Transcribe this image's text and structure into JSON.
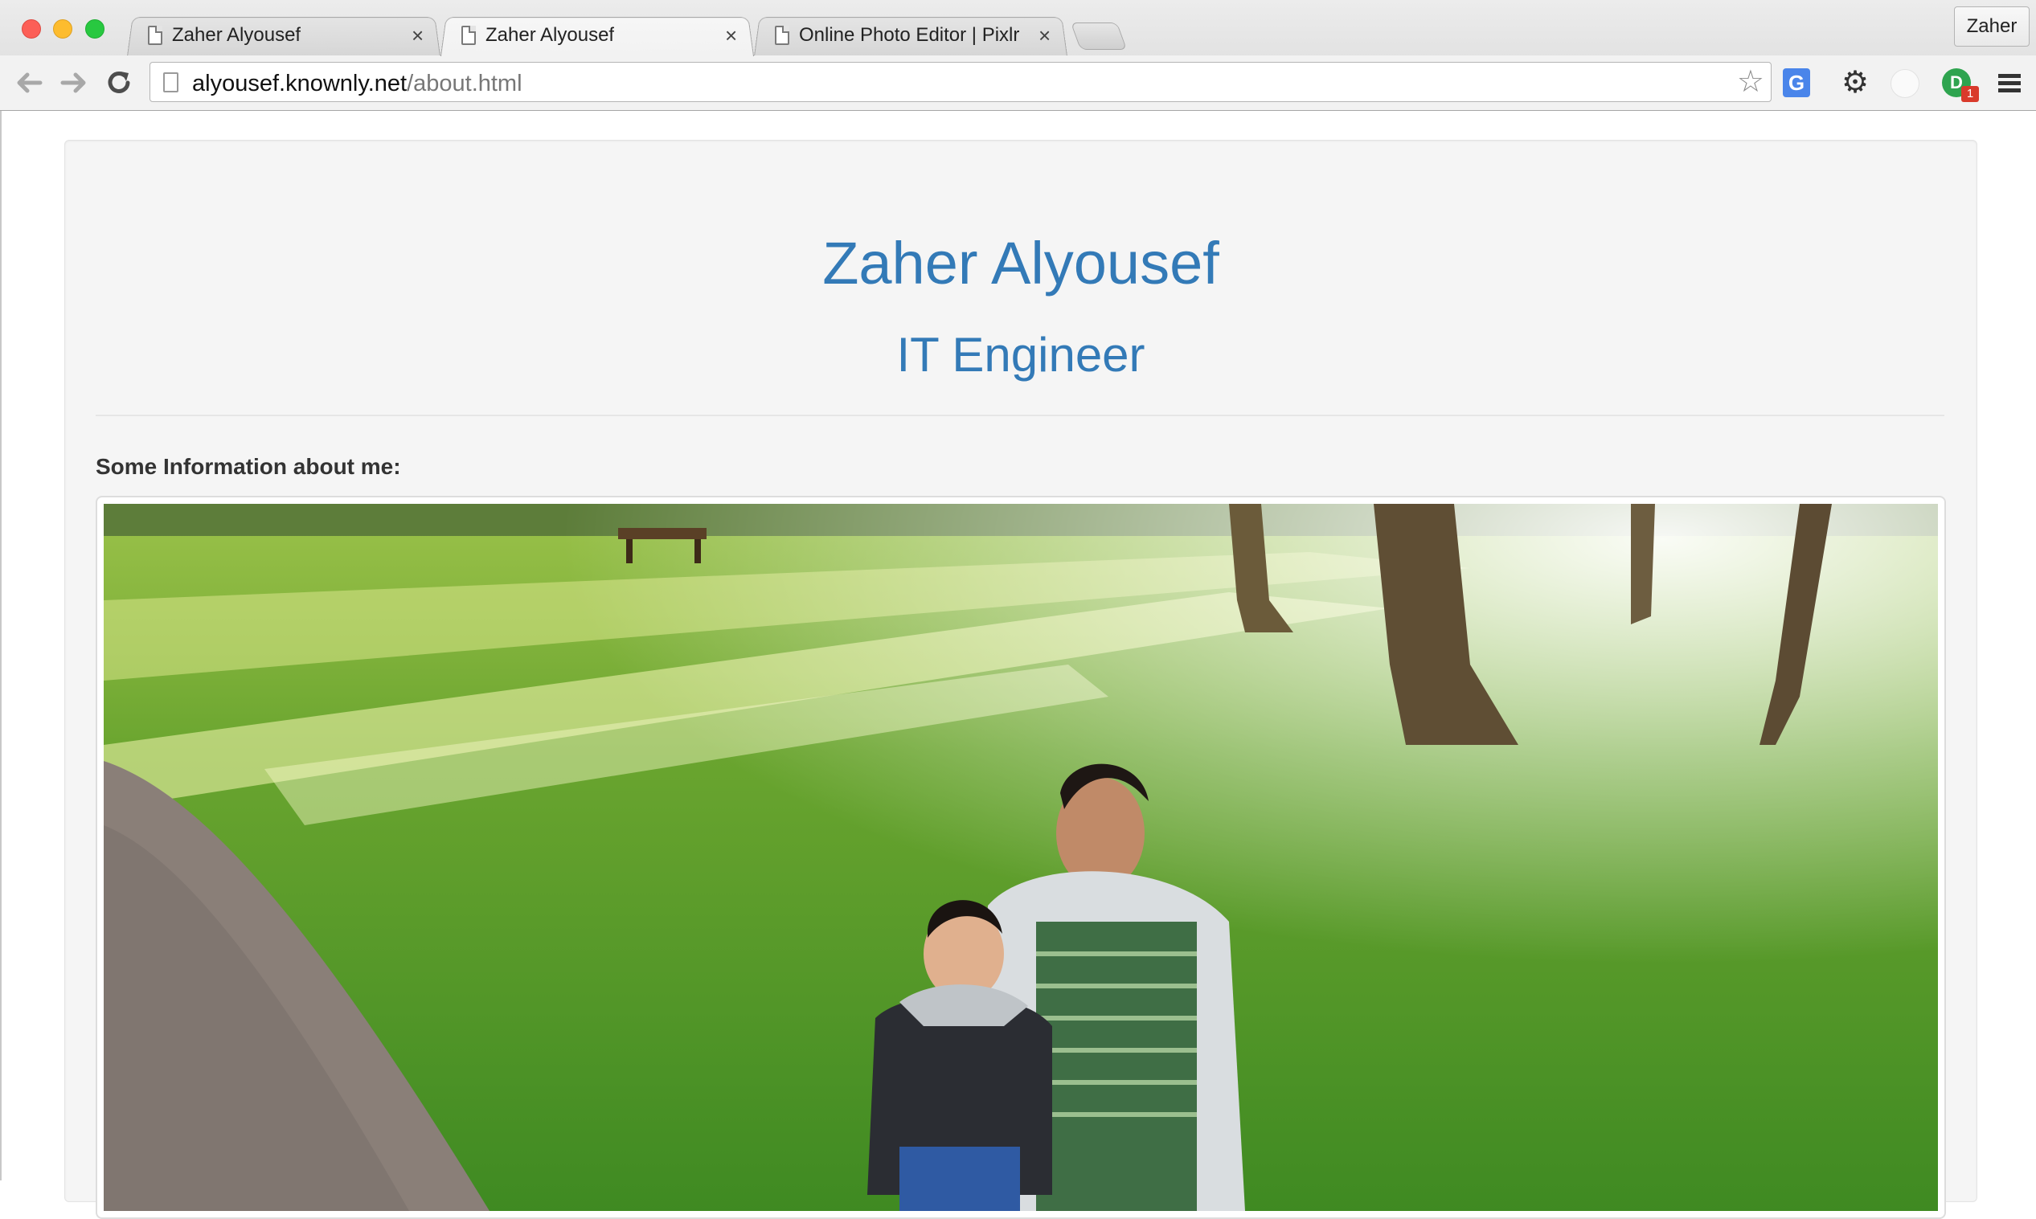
{
  "browser": {
    "tabs": [
      {
        "title": "Zaher Alyousef",
        "active": false
      },
      {
        "title": "Zaher Alyousef",
        "active": true
      },
      {
        "title": "Online Photo Editor | Pixlr E",
        "active": false
      }
    ],
    "profile_label": "Zaher",
    "url_host": "alyousef.knownly.net",
    "url_path": "/about.html",
    "extension_badge": "1"
  },
  "page": {
    "name": "Zaher Alyousef",
    "role": "IT Engineer",
    "info_heading": "Some Information about me:"
  },
  "colors": {
    "heading_blue": "#337ab7",
    "panel_bg": "#f5f5f5"
  },
  "icons": [
    "back-arrow-icon",
    "forward-arrow-icon",
    "reload-icon",
    "page-icon",
    "star-icon",
    "translate-icon",
    "gear-icon",
    "menu-icon"
  ]
}
